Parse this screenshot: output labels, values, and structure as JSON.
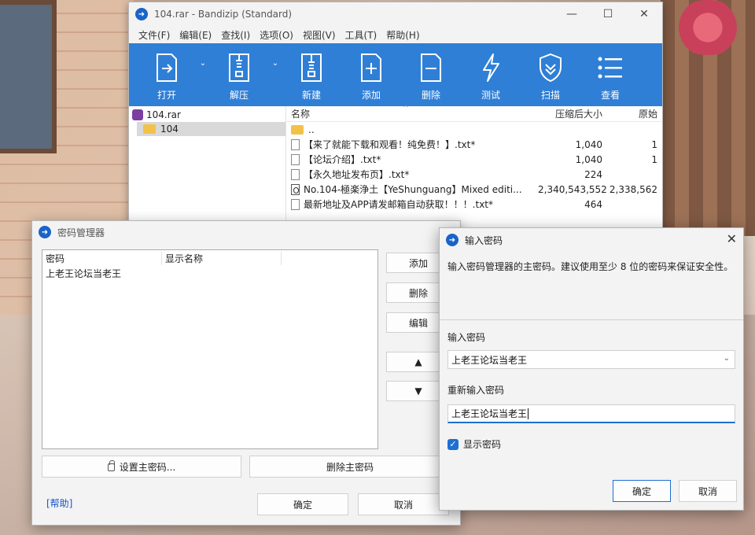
{
  "bandizip": {
    "title": "104.rar - Bandizip (Standard)",
    "menu": [
      "文件(F)",
      "编辑(E)",
      "查找(I)",
      "选项(O)",
      "视图(V)",
      "工具(T)",
      "帮助(H)"
    ],
    "toolbar": {
      "open": "打开",
      "extract": "解压",
      "new": "新建",
      "add": "添加",
      "delete": "删除",
      "test": "测试",
      "scan": "扫描",
      "view": "查看"
    },
    "tree": {
      "archive": "104.rar",
      "folder": "104"
    },
    "columns": {
      "name": "名称",
      "compressed": "压缩后大小",
      "original": "原始"
    },
    "files": [
      {
        "name": "..",
        "compressed": "",
        "original": ""
      },
      {
        "name": "【来了就能下载和观看！纯免费！】.txt*",
        "compressed": "1,040",
        "original": "1"
      },
      {
        "name": "【论坛介绍】.txt*",
        "compressed": "1,040",
        "original": "1"
      },
      {
        "name": "【永久地址发布页】.txt*",
        "compressed": "224",
        "original": ""
      },
      {
        "name": "No.104-極楽浄土【YeShunguang】Mixed editi...",
        "compressed": "2,340,543,552",
        "original": "2,338,562"
      },
      {
        "name": "最新地址及APP请发邮箱自动获取！！！.txt*",
        "compressed": "464",
        "original": ""
      }
    ]
  },
  "password_manager": {
    "title": "密码管理器",
    "col_password": "密码",
    "col_display_name": "显示名称",
    "rows": [
      {
        "password": "上老王论坛当老王",
        "display_name": ""
      }
    ],
    "add": "添加",
    "delete": "删除",
    "edit": "编辑",
    "up": "▲",
    "down": "▼",
    "set_master": "设置主密码...",
    "delete_master": "删除主密码",
    "help": "[帮助]",
    "ok": "确定",
    "cancel": "取消"
  },
  "enter_password": {
    "title": "输入密码",
    "description": "输入密码管理器的主密码。建议使用至少 8 位的密码来保证安全性。",
    "label_password": "输入密码",
    "password_value": "上老王论坛当老王",
    "label_repeat": "重新输入密码",
    "repeat_value": "上老王论坛当老王",
    "show_password": "显示密码",
    "ok": "确定",
    "cancel": "取消"
  },
  "colors": {
    "toolbar_blue": "#2f7fd6",
    "accent": "#1d6fd1"
  }
}
